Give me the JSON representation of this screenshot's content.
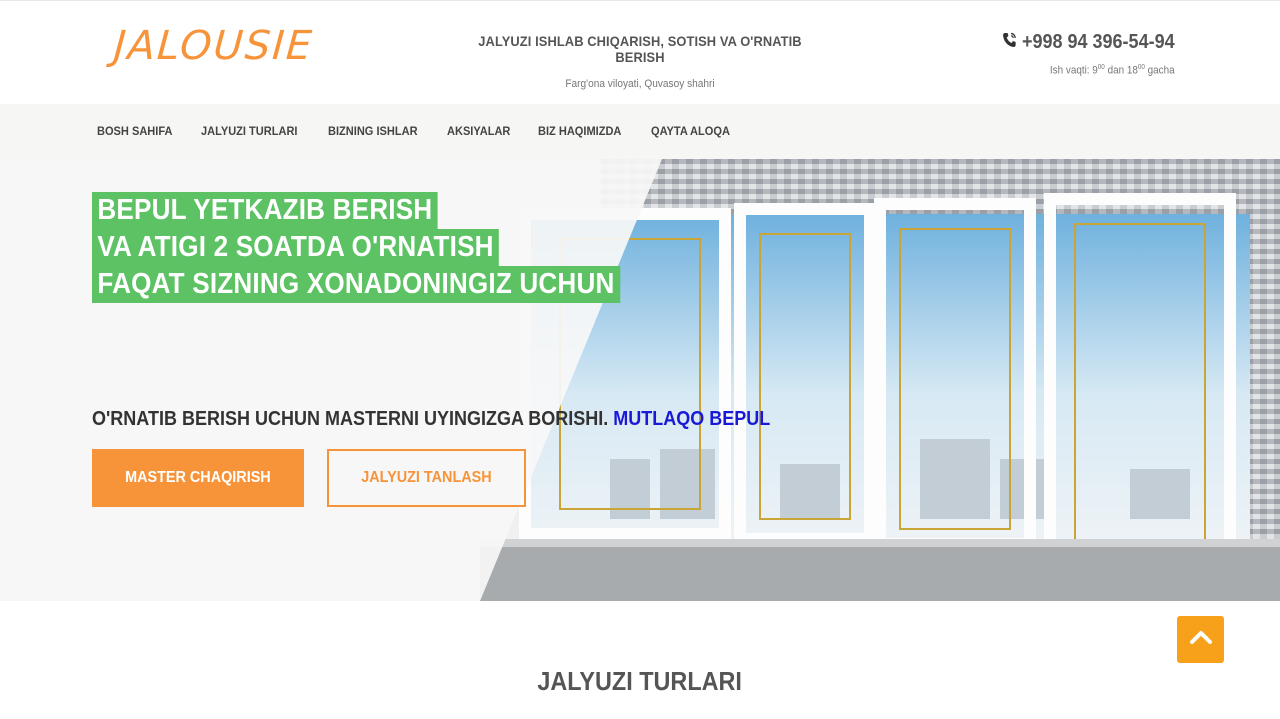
{
  "header": {
    "logo": "JALOUSIE",
    "tagline": "JALYUZI ISHLAB CHIQARISH, SOTISH VA O'RNATIB BERISH",
    "location": "Farg'ona viloyati, Quvasoy shahri",
    "phone": "+998 94 396-54-94",
    "hours_prefix": "Ish vaqti: 9",
    "hours_sup1": "00",
    "hours_mid": " dan 18",
    "hours_sup2": "00",
    "hours_suffix": " gacha"
  },
  "nav": {
    "items": [
      {
        "label": "BOSH SAHIFA"
      },
      {
        "label": "JALYUZI TURLARI"
      },
      {
        "label": "BIZNING ISHLAR"
      },
      {
        "label": "AKSIYALAR"
      },
      {
        "label": "BIZ HAQIMIZDA"
      },
      {
        "label": "QAYTA ALOQA"
      }
    ]
  },
  "hero": {
    "headline": [
      "BEPUL YETKAZIB BERISH",
      "VA ATIGI 2 SOATDA O'RNATISH",
      "FAQAT SIZNING XONADONINGIZ UCHUN"
    ],
    "subline": "O'RNATIB BERISH UCHUN MASTERNI UYINGIZGA BORISHI.",
    "subline_accent": "MUTLAQO BEPUL",
    "primary_button": "MASTER CHAQIRISH",
    "secondary_button": "JALYUZI TANLASH"
  },
  "section": {
    "title": "JALYUZI TURLARI"
  },
  "colors": {
    "accent_orange": "#f7943a",
    "headline_green": "#5cc264",
    "accent_blue": "#1a1ad6"
  },
  "icons": {
    "phone": "phone-icon",
    "scroll_top": "chevron-up-icon"
  }
}
